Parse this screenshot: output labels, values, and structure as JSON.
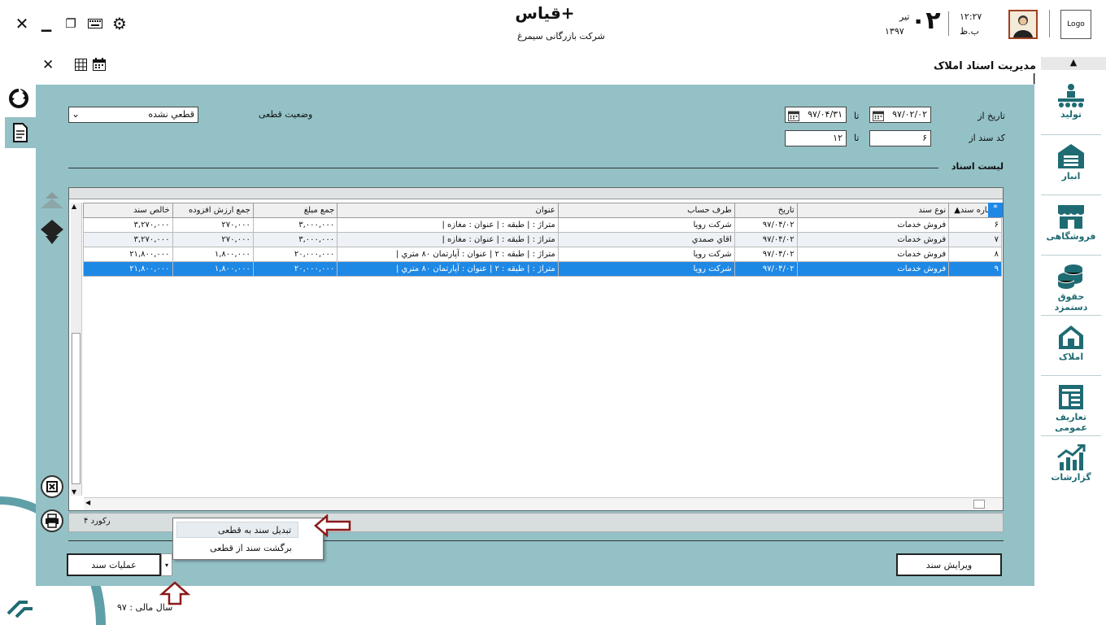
{
  "app": {
    "title": "قیاس+",
    "company": "شرکت بازرگانی سیمرغ"
  },
  "clock": {
    "time": "۱۲:۲۷",
    "ampm": "ب.ظ",
    "day": "۰۲",
    "month": "تیر",
    "year": "۱۳۹۷"
  },
  "logo": "Logo",
  "breadcrumb": "مدیریت اسناد املاک",
  "filters": {
    "date_from_label": "تاریخ از",
    "date_from": "۹۷/۰۲/۰۲",
    "to_label": "تا",
    "date_to": "۹۷/۰۴/۳۱",
    "code_from_label": "کد سند از",
    "code_from": "۶",
    "code_to": "۱۲",
    "status_label": "وضعیت قطعی",
    "status_value": "قطعي نشده"
  },
  "section_title": "لیست اسناد",
  "table": {
    "columns": [
      "شماره سند",
      "نوع سند",
      "تاریخ",
      "طرف حساب",
      "عنوان",
      "جمع مبلغ",
      "جمع ارزش افزوده",
      "خالص سند"
    ],
    "rows": [
      {
        "num": "۶",
        "type": "فروش خدمات",
        "date": "۹۷/۰۴/۰۲",
        "party": "شرکت رویا",
        "title": "متراژ :  | طبقه :  | عنوان : مغازه |",
        "amount": "۳,۰۰۰,۰۰۰",
        "vat": "۲۷۰,۰۰۰",
        "net": "۳,۲۷۰,۰۰۰"
      },
      {
        "num": "۷",
        "type": "فروش خدمات",
        "date": "۹۷/۰۴/۰۲",
        "party": "اقاي صمدي",
        "title": "متراژ :  | طبقه :  | عنوان : مغازه |",
        "amount": "۳,۰۰۰,۰۰۰",
        "vat": "۲۷۰,۰۰۰",
        "net": "۳,۲۷۰,۰۰۰"
      },
      {
        "num": "۸",
        "type": "فروش خدمات",
        "date": "۹۷/۰۴/۰۲",
        "party": "شرکت رویا",
        "title": "متراژ :  | طبقه : ۲ | عنوان : آپارتمان ۸۰ متري |",
        "amount": "۲۰,۰۰۰,۰۰۰",
        "vat": "۱,۸۰۰,۰۰۰",
        "net": "۲۱,۸۰۰,۰۰۰"
      },
      {
        "num": "۹",
        "type": "فروش خدمات",
        "date": "۹۷/۰۴/۰۲",
        "party": "شرکت رویا",
        "title": "متراژ :  | طبقه : ۲ | عنوان : آپارتمان ۸۰ متري |",
        "amount": "۲۰,۰۰۰,۰۰۰",
        "vat": "۱,۸۰۰,۰۰۰",
        "net": "۲۱,۸۰۰,۰۰۰"
      }
    ]
  },
  "records": "۴ رکورد",
  "buttons": {
    "ops": "عملیات سند",
    "edit": "ویرایش سند"
  },
  "popup": {
    "finalize": "تبدیل سند به قطعی",
    "revert": "برگشت سند از قطعی"
  },
  "fiscal_year": "سال مالی : ۹۷",
  "nav": [
    {
      "label": "تولید"
    },
    {
      "label": "انبار"
    },
    {
      "label": "فروشگاهی"
    },
    {
      "label": "حقوق دستمزد"
    },
    {
      "label": "املاک"
    },
    {
      "label": "تعاریف عمومی"
    },
    {
      "label": "گزارشات"
    }
  ],
  "colors": {
    "panel": "#93c1c6",
    "accent": "#1f6b73",
    "selection": "#1e88e5",
    "arrow": "#8b1a1a"
  }
}
